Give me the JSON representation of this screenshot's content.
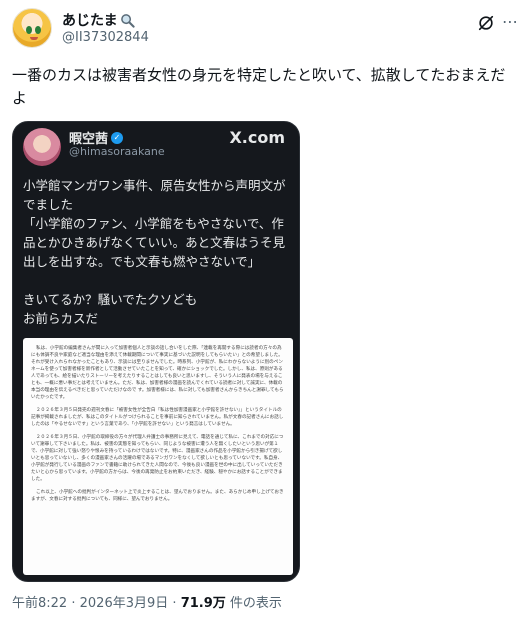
{
  "author": {
    "display_name": "あじたま",
    "handle": "@II37302844"
  },
  "tweet": {
    "text": "一番のカスは被害者女性の身元を特定したと吹いて、拡散してたおまえだよ"
  },
  "quoted": {
    "display_name": "暇空茜",
    "handle": "@himasoraakane",
    "brand": "X.com",
    "text": "小学館マンガワン事件、原告女性から声明文がでました\n「小学館のファン、小学館をもやさないで、作品とかひきあげなくていい。あと文春はうそ見出しを出すな。でも文春も燃やさないで」\n\nきいてるか？騒いでたクソども\nお前らカスだ",
    "document_paragraphs": [
      "私は、小学館の編集者さんが間に入って加害者個人と示談の話し合いをした際、「連載を再開する際には読者の方々の為にも体調不良や家庭など適当な理由を添えて休載期間について事実に基づいた説明をしてもらいたい」との希望しました。それが受け入れられなかったこともあり、示談には至りませんでした。時系列、小学館が、私にわからないように別のペンネームを使って加害者様を新作者として活動させていたことを知って、確かにショックでした。しかし、私は、原則がある人であっても、絵を描いたりストーリーを考えたりすることはしても良いと思いますし、そういう人に発表の場を与えることも、一概に悪い事だとは考えていません。ただ、私は、加害者様の漫画を読んでくれている読者に対して誠実に、休載の本当の理由を伝えるべきだと思っていただけなので す。加害者様には、私に対しても加害者さんからきちんと謝罪してもらいたかったです。",
      "２０２６年３月５日発売の週刊文春に「被害女性が全告白『私は性加害漫画家と小学館を許せない』」というタイトルの記事が掲載されましたが、私はこのタイトルがつけられることを事前に知らされていません。私が文春の記者さんにお話ししたのは「やるせないです」という言葉であり、「小学館を許せない」という発言はしていません。",
      "２０２６年３月５日、小学館の取締役の方々が代理人弁護士の事務所に見えて、電話を通じて私に、これまでの対応について謝罪して下さいました。私は、被害の実態を知ってもらい、同じような被害に遭う人を無くしたいという思いが第１で、小学館に対して強い怒りや恨みを持っているわけではないです。特に、漫画家さんの作品を小学館から引き揚げて欲しいとも思っていないし、多くの漫画家さんの活躍の場であるマンガワンをなくして欲しいとも思っていないです。私自身、小学館が発行している漫画のファンで書籍に助けられてきた人間なので、今後も良い漫画を世の中に出していっていただきたいと心から思っています。小学館の方からは、今後の再発防止をお約束いただき、経験、穏やかにお話することができました。",
      "これ以上、小学館への批判がインターネット上で炎上することは、望んでおりません。また、あらかじめ申し上げておきますが、文春に対する批判についても、同様に、望んでおりません。"
    ]
  },
  "meta": {
    "time": "午前8:22",
    "separator": "·",
    "date": "2026年3月9日",
    "views": "71.9万",
    "views_suffix": "件の表示"
  }
}
